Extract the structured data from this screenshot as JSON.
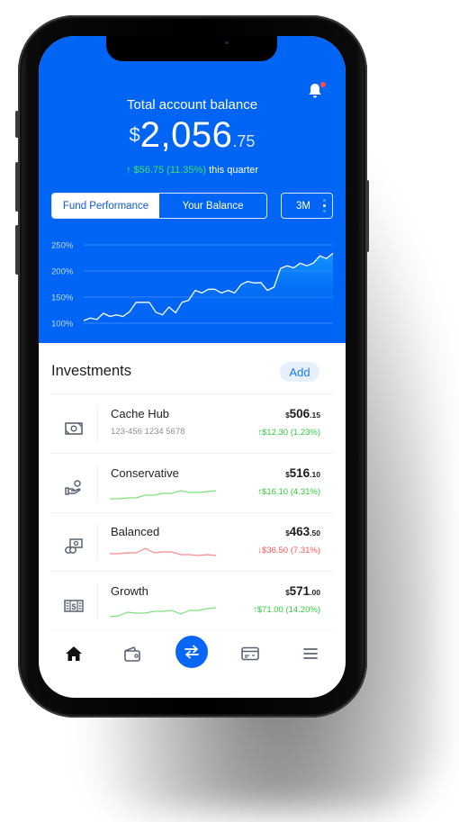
{
  "header": {
    "title": "Total account balance",
    "balance": {
      "currency": "$",
      "whole": "2,056",
      "cents": ".75"
    },
    "delta": {
      "arrow": "↑",
      "amount": "$56.75 (11.35%)",
      "suffix": "this quarter"
    },
    "notification_badge": true
  },
  "tabs": {
    "items": [
      {
        "label": "Fund Performance",
        "active": true
      },
      {
        "label": "Your Balance",
        "active": false
      }
    ],
    "period": "3M"
  },
  "colors": {
    "brand": "#0064f5",
    "positive": "#33cc3c",
    "negative": "#ff5555",
    "add_bg": "#e6f1fd",
    "add_text": "#1a7ae8"
  },
  "chart_data": {
    "type": "area",
    "title": "Fund Performance",
    "yticks": [
      "250%",
      "200%",
      "150%",
      "100%"
    ],
    "ylim": [
      100,
      250
    ],
    "grid": true,
    "values": [
      105,
      110,
      107,
      119,
      113,
      116,
      113,
      122,
      140,
      140,
      140,
      121,
      116,
      131,
      120,
      140,
      144,
      163,
      158,
      165,
      165,
      158,
      163,
      158,
      174,
      180,
      177,
      178,
      163,
      169,
      205,
      210,
      206,
      215,
      210,
      215,
      229,
      224,
      234
    ]
  },
  "investments": {
    "heading": "Investments",
    "add_label": "Add",
    "items": [
      {
        "name": "Cache Hub",
        "sub": "123-456 1234 5678",
        "icon": "banknote-icon",
        "amount_prefix": "$",
        "amount": "506",
        "cents": ".15",
        "change": "↑$12.30 (1.23%)",
        "trend": "up",
        "spark": null
      },
      {
        "name": "Conservative",
        "icon": "hand-coin-icon",
        "amount_prefix": "$",
        "amount": "516",
        "cents": ".10",
        "change": "↑$16.10 (4.31%)",
        "trend": "up",
        "spark": [
          2,
          2,
          3,
          3,
          6,
          6,
          8,
          8,
          11,
          9,
          9,
          10,
          11
        ]
      },
      {
        "name": "Balanced",
        "icon": "money-coins-icon",
        "amount_prefix": "$",
        "amount": "463",
        "cents": ".50",
        "change": "↓$36.50 (7.31%)",
        "trend": "down",
        "spark": [
          6,
          6,
          7,
          7,
          12,
          7,
          8,
          8,
          5,
          5,
          4,
          5,
          4
        ]
      },
      {
        "name": "Growth",
        "icon": "cash-stack-icon",
        "amount_prefix": "$",
        "amount": "571",
        "cents": ".00",
        "change": "↑$71.00 (14.20%)",
        "trend": "up",
        "spark": [
          2,
          3,
          7,
          6,
          6,
          8,
          8,
          9,
          5,
          9,
          9,
          11,
          12
        ]
      }
    ]
  },
  "nav": {
    "items": [
      {
        "icon": "home-icon",
        "active": true
      },
      {
        "icon": "wallet-icon",
        "active": false
      },
      {
        "icon": "transfer-icon",
        "active": false
      },
      {
        "icon": "card-icon",
        "active": false
      },
      {
        "icon": "menu-icon",
        "active": false
      }
    ]
  }
}
